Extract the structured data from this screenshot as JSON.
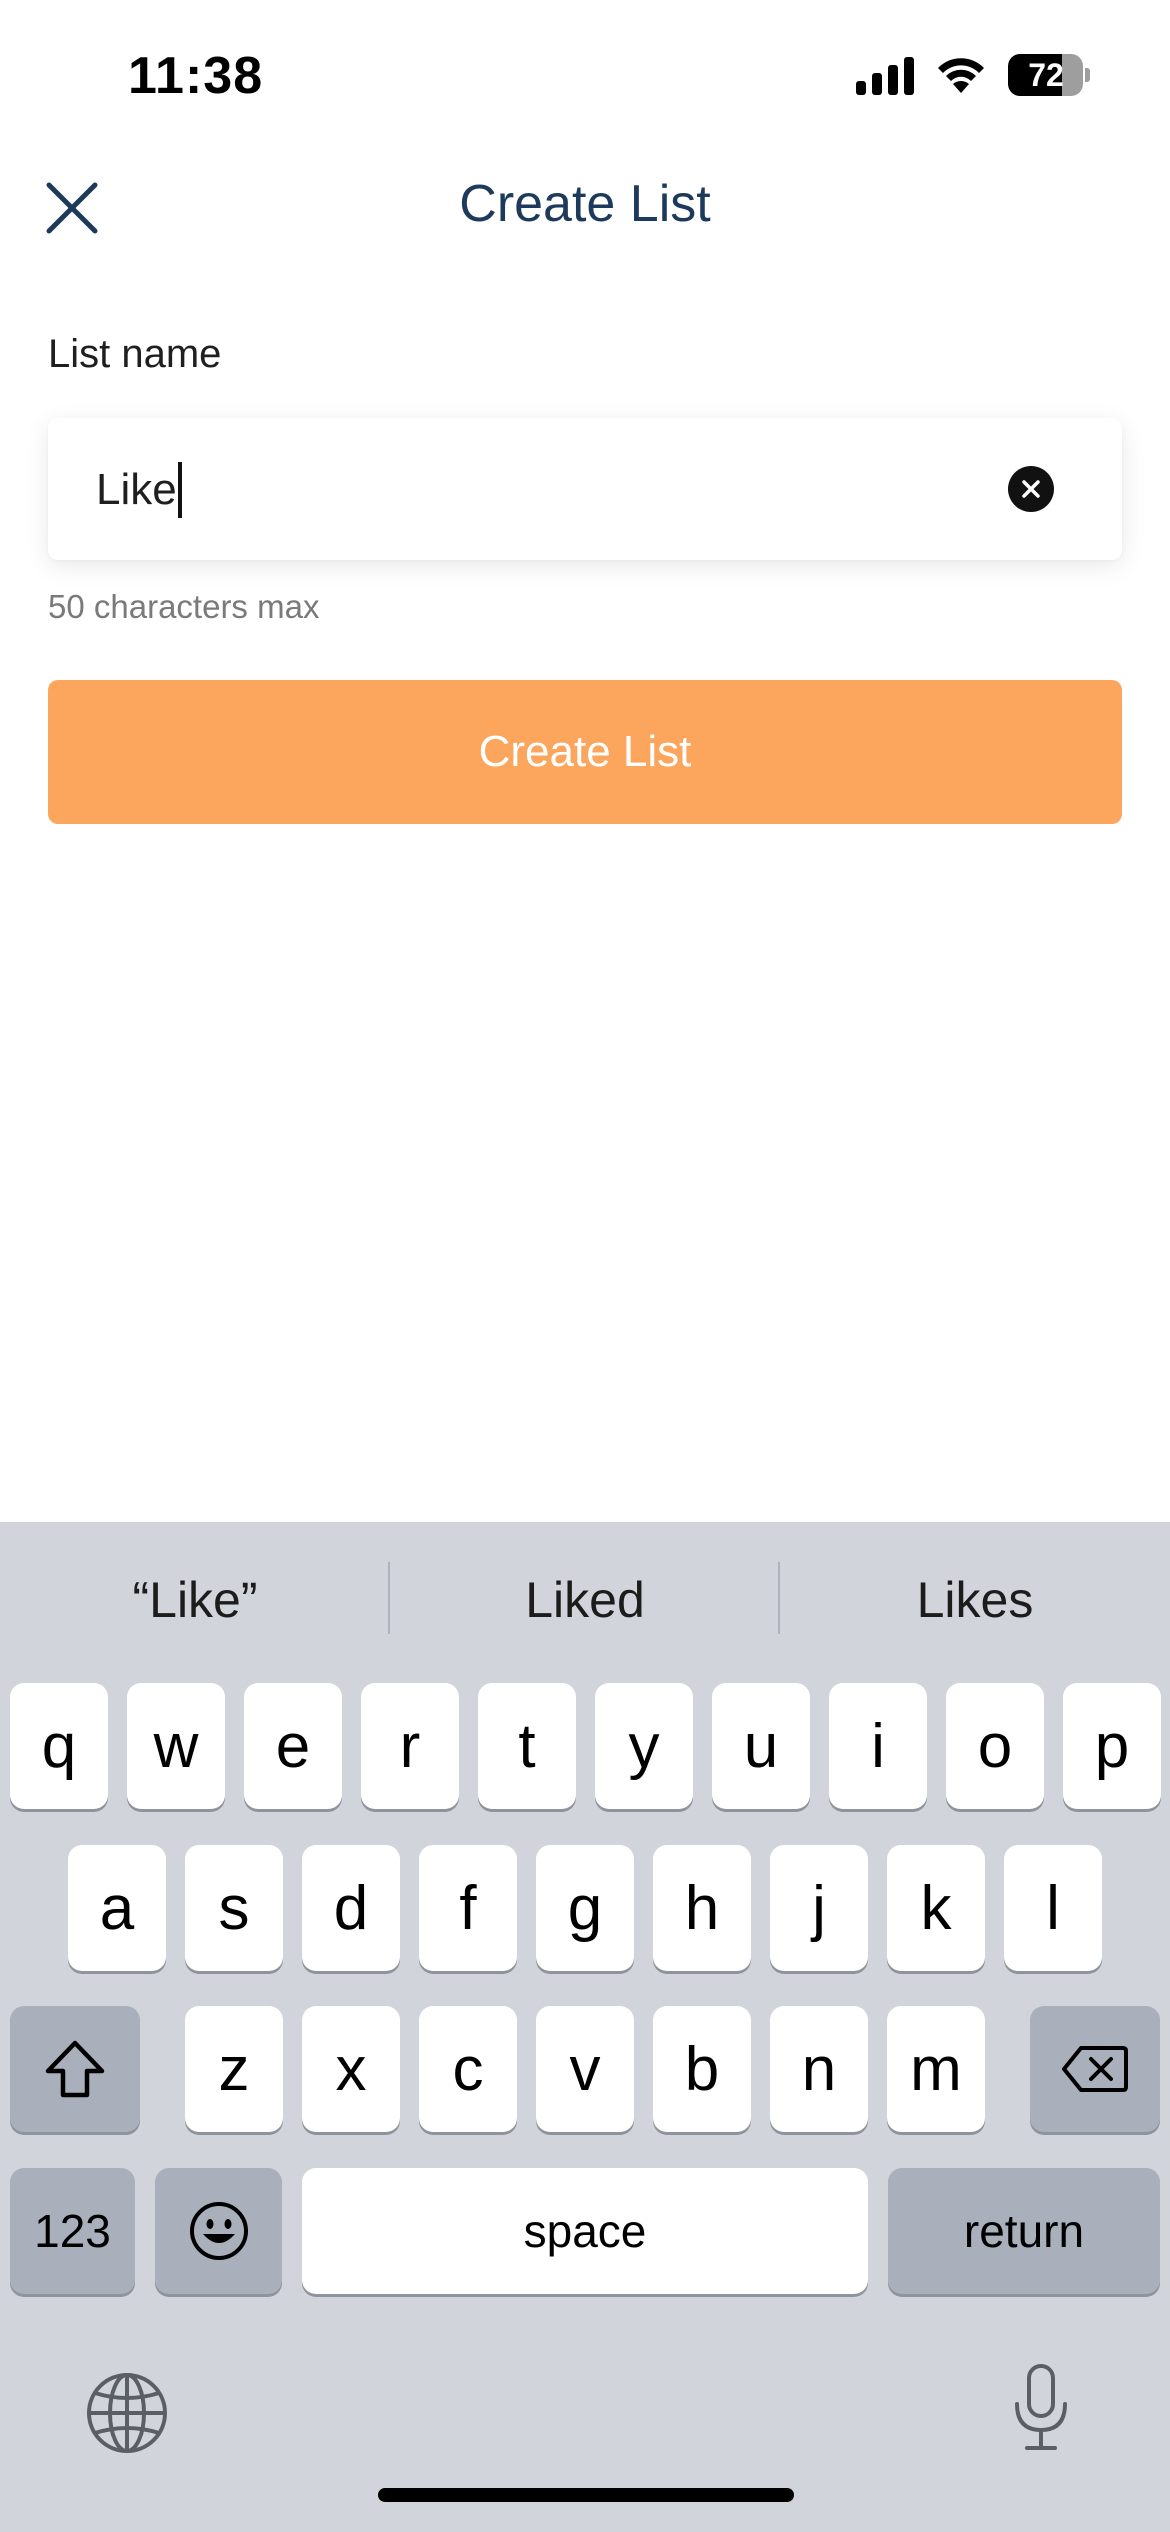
{
  "status_bar": {
    "time": "11:38",
    "battery": "72",
    "battery_level": 0.72,
    "icons": [
      "signal-icon",
      "wifi-icon",
      "battery-icon"
    ]
  },
  "header": {
    "title": "Create List",
    "close_icon": "close-icon"
  },
  "form": {
    "label": "List name",
    "input_value": "Like",
    "clear_icon": "clear-icon",
    "helper": "50 characters max",
    "submit_label": "Create List"
  },
  "keyboard": {
    "suggestions": [
      "“Like”",
      "Liked",
      "Likes"
    ],
    "row1": [
      "q",
      "w",
      "e",
      "r",
      "t",
      "y",
      "u",
      "i",
      "o",
      "p"
    ],
    "row2": [
      "a",
      "s",
      "d",
      "f",
      "g",
      "h",
      "j",
      "k",
      "l"
    ],
    "row3": [
      "z",
      "x",
      "c",
      "v",
      "b",
      "n",
      "m"
    ],
    "numbers_label": "123",
    "space_label": "space",
    "return_label": "return",
    "icons": [
      "shift-icon",
      "delete-icon",
      "emoji-icon",
      "globe-icon",
      "microphone-icon"
    ]
  },
  "colors": {
    "accent": "#fca55c",
    "title": "#1d3a5c",
    "keyboard_bg": "#d1d4db"
  }
}
